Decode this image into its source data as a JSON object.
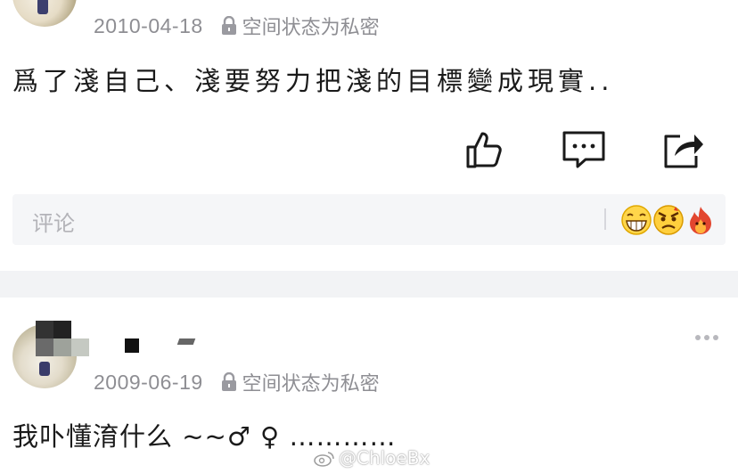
{
  "post1": {
    "date": "2010-04-18",
    "privacy": "空间状态为私密",
    "content": "爲了淺自己、淺要努力把淺的目標變成現實..",
    "actions": {
      "like_icon": "thumbs-up-icon",
      "comment_icon": "comment-bubble-icon",
      "share_icon": "share-arrow-icon"
    },
    "comment_placeholder": "评论",
    "emojis": [
      "grinning-face-emoji",
      "angry-face-emoji",
      "fire-emoji"
    ]
  },
  "post2": {
    "date": "2009-06-19",
    "privacy": "空间状态为私密",
    "content": "我卟懂淯什么 ~~♂ ♀ …………",
    "more_icon": "more-dots-icon"
  },
  "watermark": "@ChloeBx",
  "colors": {
    "meta_gray": "#8e8e93",
    "text": "#1a1a1a",
    "bar_bg": "#f5f6f8",
    "divider_bg": "#f2f3f5"
  }
}
